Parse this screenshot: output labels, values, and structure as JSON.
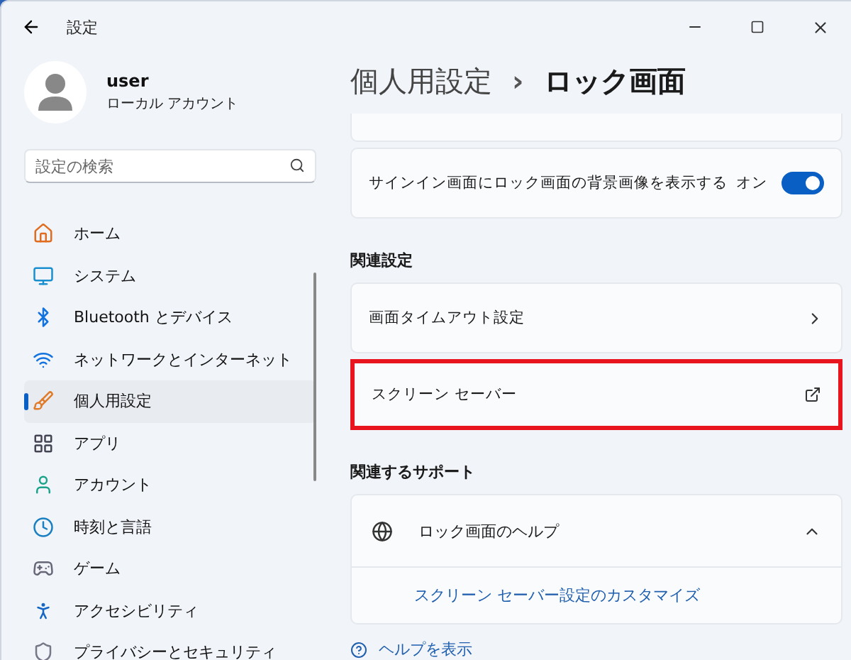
{
  "window": {
    "title": "設定"
  },
  "account": {
    "name": "user",
    "type": "ローカル アカウント"
  },
  "search": {
    "placeholder": "設定の検索"
  },
  "sidebar": {
    "items": [
      {
        "label": "ホーム",
        "selected": false
      },
      {
        "label": "システム",
        "selected": false
      },
      {
        "label": "Bluetooth とデバイス",
        "selected": false
      },
      {
        "label": "ネットワークとインターネット",
        "selected": false
      },
      {
        "label": "個人用設定",
        "selected": true
      },
      {
        "label": "アプリ",
        "selected": false
      },
      {
        "label": "アカウント",
        "selected": false
      },
      {
        "label": "時刻と言語",
        "selected": false
      },
      {
        "label": "ゲーム",
        "selected": false
      },
      {
        "label": "アクセシビリティ",
        "selected": false
      },
      {
        "label": "プライバシーとセキュリティ",
        "selected": false
      }
    ]
  },
  "breadcrumb": {
    "parent": "個人用設定",
    "separator": "›",
    "current": "ロック画面"
  },
  "settings": [
    {
      "label": "サインイン画面にロック画面の背景画像を表示する",
      "state_text": "オン",
      "on": true
    }
  ],
  "related": {
    "heading": "関連設定",
    "items": [
      {
        "label": "画面タイムアウト設定",
        "kind": "chevron",
        "highlighted": false
      },
      {
        "label": "スクリーン セーバー",
        "kind": "external",
        "highlighted": true
      }
    ]
  },
  "support": {
    "heading": "関連するサポート",
    "title": "ロック画面のヘルプ",
    "expanded": true,
    "links": [
      "スクリーン セーバー設定のカスタマイズ"
    ]
  },
  "footer_link": "ヘルプを表示"
}
